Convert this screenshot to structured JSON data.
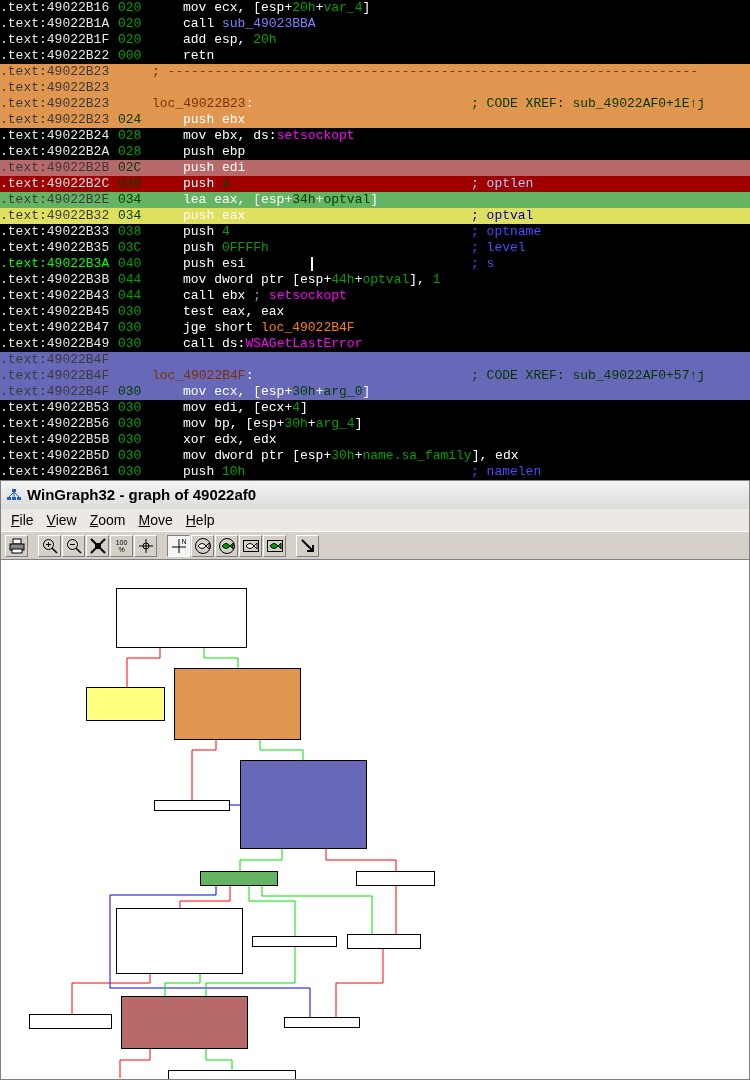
{
  "listing": [
    {
      "kind": "instr",
      "address": ".text:49022B16",
      "stack": "020",
      "current": false,
      "tokens": [
        {
          "kind": "text",
          "text": "mov ecx, [esp+"
        },
        {
          "kind": "num",
          "text": "20h"
        },
        {
          "kind": "text",
          "text": "+"
        },
        {
          "kind": "var",
          "text": "var_4"
        },
        {
          "kind": "text",
          "text": "]"
        }
      ]
    },
    {
      "kind": "instr",
      "address": ".text:49022B1A",
      "stack": "020",
      "current": false,
      "tokens": [
        {
          "kind": "text",
          "text": "call "
        },
        {
          "kind": "sub",
          "text": "sub_49023BBA"
        }
      ]
    },
    {
      "kind": "instr",
      "address": ".text:49022B1F",
      "stack": "020",
      "current": false,
      "tokens": [
        {
          "kind": "text",
          "text": "add esp, "
        },
        {
          "kind": "num",
          "text": "20h"
        }
      ]
    },
    {
      "kind": "instr",
      "address": ".text:49022B22",
      "stack": "000",
      "current": false,
      "tokens": [
        {
          "kind": "text",
          "text": "retn"
        }
      ]
    },
    {
      "kind": "separator",
      "address": ".text:49022B23",
      "current": false,
      "color": "#e0964f",
      "tokens": [
        {
          "kind": "sep",
          "text": "; --------------------------------------------------------------------"
        }
      ]
    },
    {
      "kind": "blank",
      "address": ".text:49022B23",
      "current": false,
      "color": "#e0964f"
    },
    {
      "kind": "label",
      "address": ".text:49022B23",
      "current": false,
      "color": "#e0964f",
      "tokens": [
        {
          "kind": "label",
          "text": "loc_49022B23"
        },
        {
          "kind": "text",
          "text": ":"
        }
      ],
      "comment": {
        "kind": "xref",
        "text": "; CODE XREF: sub_49022AF0+1E↑j"
      }
    },
    {
      "kind": "instr",
      "address": ".text:49022B23",
      "stack": "024",
      "current": false,
      "color": "#e0964f",
      "tokens": [
        {
          "kind": "text",
          "text": "push ebx"
        }
      ]
    },
    {
      "kind": "instr",
      "address": ".text:49022B24",
      "stack": "028",
      "current": false,
      "tokens": [
        {
          "kind": "text",
          "text": "mov ebx, ds:"
        },
        {
          "kind": "api",
          "text": "setsockopt"
        }
      ]
    },
    {
      "kind": "instr",
      "address": ".text:49022B2A",
      "stack": "028",
      "current": false,
      "tokens": [
        {
          "kind": "text",
          "text": "push ebp"
        }
      ]
    },
    {
      "kind": "instr",
      "address": ".text:49022B2B",
      "stack": "02C",
      "current": false,
      "color": "#b86a6a",
      "tokens": [
        {
          "kind": "text",
          "text": "push edi"
        }
      ]
    },
    {
      "kind": "instr",
      "address": ".text:49022B2C",
      "stack": "030",
      "current": false,
      "color": "#9e0000",
      "tokens": [
        {
          "kind": "text",
          "text": "push "
        },
        {
          "kind": "num",
          "text": "4"
        }
      ],
      "comment": {
        "kind": "comment",
        "text": "; optlen"
      }
    },
    {
      "kind": "instr",
      "address": ".text:49022B2E",
      "stack": "034",
      "current": false,
      "color": "#64b464",
      "tokens": [
        {
          "kind": "text",
          "text": "lea eax, [esp+"
        },
        {
          "kind": "num",
          "text": "34h"
        },
        {
          "kind": "text",
          "text": "+"
        },
        {
          "kind": "var",
          "text": "optval"
        },
        {
          "kind": "text",
          "text": "]"
        }
      ]
    },
    {
      "kind": "instr",
      "address": ".text:49022B32",
      "stack": "034",
      "current": false,
      "color": "#e0e060",
      "tokens": [
        {
          "kind": "text",
          "text": "push eax"
        }
      ],
      "comment": {
        "kind": "comment",
        "text": "; optval"
      }
    },
    {
      "kind": "instr",
      "address": ".text:49022B33",
      "stack": "038",
      "current": false,
      "tokens": [
        {
          "kind": "text",
          "text": "push "
        },
        {
          "kind": "num",
          "text": "4"
        }
      ],
      "comment": {
        "kind": "comment",
        "text": "; optname"
      }
    },
    {
      "kind": "instr",
      "address": ".text:49022B35",
      "stack": "03C",
      "current": false,
      "tokens": [
        {
          "kind": "text",
          "text": "push "
        },
        {
          "kind": "num",
          "text": "0FFFFh"
        }
      ],
      "comment": {
        "kind": "comment",
        "text": "; level"
      }
    },
    {
      "kind": "instr",
      "address": ".text:49022B3A",
      "stack": "040",
      "current": true,
      "tokens": [
        {
          "kind": "text",
          "text": "push esi"
        }
      ],
      "comment": {
        "kind": "comment",
        "text": "; s"
      }
    },
    {
      "kind": "instr",
      "address": ".text:49022B3B",
      "stack": "044",
      "current": false,
      "tokens": [
        {
          "kind": "text",
          "text": "mov dword ptr [esp+"
        },
        {
          "kind": "num",
          "text": "44h"
        },
        {
          "kind": "text",
          "text": "+"
        },
        {
          "kind": "var",
          "text": "optval"
        },
        {
          "kind": "text",
          "text": "], "
        },
        {
          "kind": "num",
          "text": "1"
        }
      ]
    },
    {
      "kind": "instr",
      "address": ".text:49022B43",
      "stack": "044",
      "current": false,
      "tokens": [
        {
          "kind": "text",
          "text": "call ebx "
        },
        {
          "kind": "sep",
          "text": "; "
        },
        {
          "kind": "api",
          "text": "setsockopt"
        }
      ]
    },
    {
      "kind": "instr",
      "address": ".text:49022B45",
      "stack": "030",
      "current": false,
      "tokens": [
        {
          "kind": "text",
          "text": "test eax, eax"
        }
      ]
    },
    {
      "kind": "instr",
      "address": ".text:49022B47",
      "stack": "030",
      "current": false,
      "tokens": [
        {
          "kind": "text",
          "text": "jge short "
        },
        {
          "kind": "label",
          "text": "loc_49022B4F"
        }
      ]
    },
    {
      "kind": "instr",
      "address": ".text:49022B49",
      "stack": "030",
      "current": false,
      "tokens": [
        {
          "kind": "text",
          "text": "call ds:"
        },
        {
          "kind": "api",
          "text": "WSAGetLastError"
        }
      ]
    },
    {
      "kind": "blank",
      "address": ".text:49022B4F",
      "current": false,
      "color": "#6868b8"
    },
    {
      "kind": "label",
      "address": ".text:49022B4F",
      "current": false,
      "color": "#6868b8",
      "tokens": [
        {
          "kind": "label",
          "text": "loc_49022B4F"
        },
        {
          "kind": "text",
          "text": ":"
        }
      ],
      "comment": {
        "kind": "xref",
        "text": "; CODE XREF: sub_49022AF0+57↑j"
      }
    },
    {
      "kind": "instr",
      "address": ".text:49022B4F",
      "stack": "030",
      "current": false,
      "color": "#6868b8",
      "tokens": [
        {
          "kind": "text",
          "text": "mov ecx, [esp+"
        },
        {
          "kind": "num",
          "text": "30h"
        },
        {
          "kind": "text",
          "text": "+"
        },
        {
          "kind": "var",
          "text": "arg_0"
        },
        {
          "kind": "text",
          "text": "]"
        }
      ]
    },
    {
      "kind": "instr",
      "address": ".text:49022B53",
      "stack": "030",
      "current": false,
      "tokens": [
        {
          "kind": "text",
          "text": "mov edi, [ecx+"
        },
        {
          "kind": "num",
          "text": "4"
        },
        {
          "kind": "text",
          "text": "]"
        }
      ]
    },
    {
      "kind": "instr",
      "address": ".text:49022B56",
      "stack": "030",
      "current": false,
      "tokens": [
        {
          "kind": "text",
          "text": "mov bp, [esp+"
        },
        {
          "kind": "num",
          "text": "30h"
        },
        {
          "kind": "text",
          "text": "+"
        },
        {
          "kind": "var",
          "text": "arg_4"
        },
        {
          "kind": "text",
          "text": "]"
        }
      ]
    },
    {
      "kind": "instr",
      "address": ".text:49022B5B",
      "stack": "030",
      "current": false,
      "tokens": [
        {
          "kind": "text",
          "text": "xor edx, edx"
        }
      ]
    },
    {
      "kind": "instr",
      "address": ".text:49022B5D",
      "stack": "030",
      "current": false,
      "tokens": [
        {
          "kind": "text",
          "text": "mov dword ptr [esp+"
        },
        {
          "kind": "num",
          "text": "30h"
        },
        {
          "kind": "text",
          "text": "+"
        },
        {
          "kind": "var",
          "text": "name.sa_family"
        },
        {
          "kind": "text",
          "text": "], edx"
        }
      ]
    },
    {
      "kind": "instr",
      "address": ".text:49022B61",
      "stack": "030",
      "current": false,
      "tokens": [
        {
          "kind": "text",
          "text": "push "
        },
        {
          "kind": "num",
          "text": "10h"
        }
      ],
      "comment": {
        "kind": "comment",
        "text": "; namelen"
      }
    }
  ],
  "window": {
    "title": "WinGraph32 - graph of 49022af0"
  },
  "menu": [
    "File",
    "View",
    "Zoom",
    "Move",
    "Help"
  ],
  "toolbar": [
    {
      "kind": "print",
      "selected": false
    },
    {
      "kind": "separator"
    },
    {
      "kind": "zoom-in",
      "selected": false
    },
    {
      "kind": "zoom-out",
      "selected": false
    },
    {
      "kind": "fit",
      "selected": false
    },
    {
      "kind": "percent",
      "label": "100",
      "sublabel": "%",
      "selected": false
    },
    {
      "kind": "center",
      "selected": false
    },
    {
      "kind": "separator"
    },
    {
      "kind": "layout",
      "label": "N",
      "selected": true
    },
    {
      "kind": "fish",
      "selected": false
    },
    {
      "kind": "fish-fill",
      "selected": false
    },
    {
      "kind": "fish-frame",
      "selected": false
    },
    {
      "kind": "fish-fill-frame",
      "selected": false
    },
    {
      "kind": "separator"
    },
    {
      "kind": "arrow",
      "selected": false
    }
  ],
  "graph": {
    "nodes": [
      {
        "color": "#ffffff"
      },
      {
        "color": "#ffff80"
      },
      {
        "color": "#e0964f"
      },
      {
        "color": "#ffffff"
      },
      {
        "color": "#6868b8"
      },
      {
        "color": "#64b464"
      },
      {
        "color": "#ffffff"
      },
      {
        "color": "#ffffff"
      },
      {
        "color": "#ffffff"
      },
      {
        "color": "#ffffff"
      },
      {
        "color": "#ffffff"
      },
      {
        "color": "#b86a6a"
      },
      {
        "color": "#ffffff"
      },
      {
        "color": "#ffffff"
      }
    ]
  }
}
